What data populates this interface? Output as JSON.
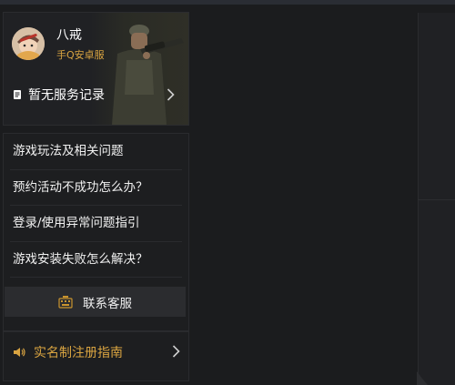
{
  "profile": {
    "name": "八戒",
    "server": "手Q安卓服",
    "service_record": "暂无服务记录"
  },
  "faq": {
    "items": [
      "游戏玩法及相关问题",
      "预约活动不成功怎么办？",
      "登录/使用异常问题指引",
      "游戏安装失败怎么解决？"
    ],
    "contact_label": "联系客服"
  },
  "realname": {
    "label": "实名制注册指南"
  },
  "colors": {
    "accent_gold": "#d9a441",
    "background": "#1b1c1e",
    "card": "#1d1e20"
  }
}
